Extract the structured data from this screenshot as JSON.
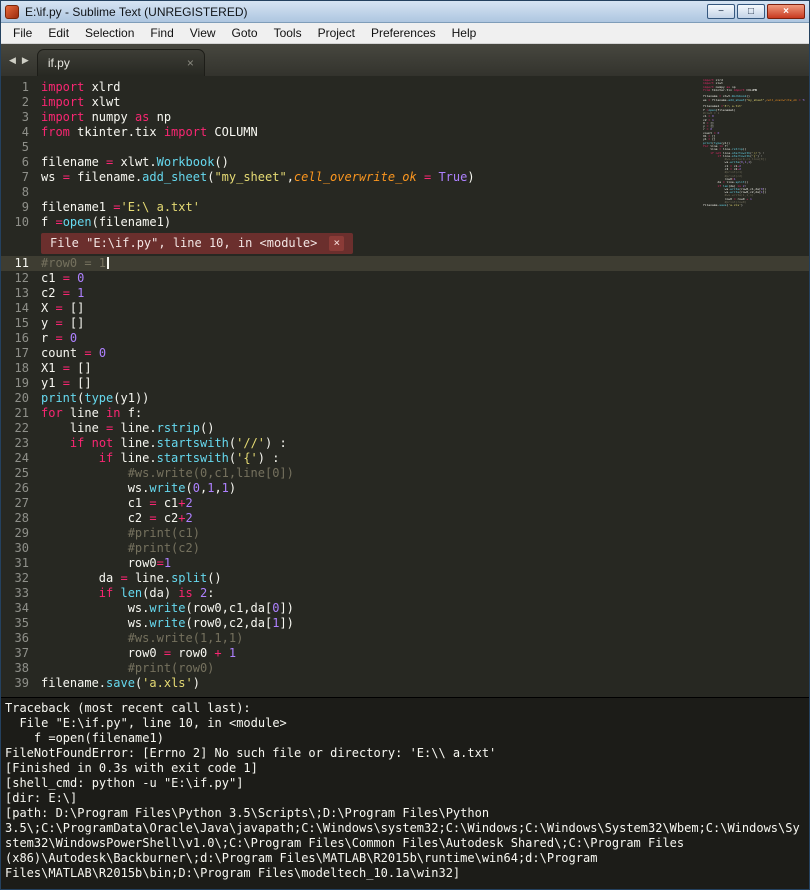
{
  "window": {
    "title": "E:\\if.py - Sublime Text (UNREGISTERED)",
    "controls": {
      "minimize": "−",
      "maximize": "□",
      "close": "×"
    }
  },
  "menu": {
    "items": [
      "File",
      "Edit",
      "Selection",
      "Find",
      "View",
      "Goto",
      "Tools",
      "Project",
      "Preferences",
      "Help"
    ]
  },
  "tabbar": {
    "nav_left": "◀",
    "nav_right": "▶"
  },
  "tabs": [
    {
      "label": "if.py",
      "close": "×"
    }
  ],
  "phantom": {
    "text": "File \"E:\\if.py\", line 10, in <module>",
    "close": "×"
  },
  "colors": {
    "editor_bg": "#272822",
    "keyword": "#f92672",
    "string": "#e6db74",
    "comment": "#75715e",
    "function": "#66d9ef",
    "constant": "#ae81ff",
    "parameter": "#fd971f",
    "plain": "#f8f8f2",
    "phantom_bg": "#6b2f2d",
    "active_line_bg": "#3e3d32"
  },
  "editor": {
    "active_line": 11,
    "phantom_after": 10,
    "lines": [
      {
        "n": 1,
        "t": [
          [
            "k",
            "import"
          ],
          [
            "p",
            " xlrd"
          ]
        ]
      },
      {
        "n": 2,
        "t": [
          [
            "k",
            "import"
          ],
          [
            "p",
            " xlwt"
          ]
        ]
      },
      {
        "n": 3,
        "t": [
          [
            "k",
            "import"
          ],
          [
            "p",
            " numpy "
          ],
          [
            "k",
            "as"
          ],
          [
            "p",
            " np"
          ]
        ]
      },
      {
        "n": 4,
        "t": [
          [
            "k",
            "from"
          ],
          [
            "p",
            " tkinter.tix "
          ],
          [
            "k",
            "import"
          ],
          [
            "p",
            " COLUMN"
          ]
        ]
      },
      {
        "n": 5,
        "t": []
      },
      {
        "n": 6,
        "t": [
          [
            "p",
            "filename "
          ],
          [
            "k",
            "="
          ],
          [
            "p",
            " xlwt."
          ],
          [
            "f",
            "Workbook"
          ],
          [
            "p",
            "()"
          ]
        ]
      },
      {
        "n": 7,
        "t": [
          [
            "p",
            "ws "
          ],
          [
            "k",
            "="
          ],
          [
            "p",
            " filename."
          ],
          [
            "f",
            "add_sheet"
          ],
          [
            "p",
            "("
          ],
          [
            "s",
            "\"my_sheet\""
          ],
          [
            "p",
            ","
          ],
          [
            "a",
            "cell_overwrite_ok"
          ],
          [
            "p",
            " "
          ],
          [
            "k",
            "="
          ],
          [
            "p",
            " "
          ],
          [
            "d",
            "True"
          ],
          [
            "p",
            ")"
          ]
        ]
      },
      {
        "n": 8,
        "t": []
      },
      {
        "n": 9,
        "t": [
          [
            "p",
            "filename1 "
          ],
          [
            "k",
            "="
          ],
          [
            "s",
            "'E:\\ a.txt'"
          ]
        ]
      },
      {
        "n": 10,
        "t": [
          [
            "p",
            "f "
          ],
          [
            "k",
            "="
          ],
          [
            "f",
            "open"
          ],
          [
            "p",
            "(filename1)"
          ]
        ]
      },
      {
        "n": 11,
        "t": [
          [
            "c",
            "#row0 = 1"
          ]
        ]
      },
      {
        "n": 12,
        "t": [
          [
            "p",
            "c1 "
          ],
          [
            "k",
            "="
          ],
          [
            "p",
            " "
          ],
          [
            "d",
            "0"
          ]
        ]
      },
      {
        "n": 13,
        "t": [
          [
            "p",
            "c2 "
          ],
          [
            "k",
            "="
          ],
          [
            "p",
            " "
          ],
          [
            "d",
            "1"
          ]
        ]
      },
      {
        "n": 14,
        "t": [
          [
            "p",
            "X "
          ],
          [
            "k",
            "="
          ],
          [
            "p",
            " []"
          ]
        ]
      },
      {
        "n": 15,
        "t": [
          [
            "p",
            "y "
          ],
          [
            "k",
            "="
          ],
          [
            "p",
            " []"
          ]
        ]
      },
      {
        "n": 16,
        "t": [
          [
            "p",
            "r "
          ],
          [
            "k",
            "="
          ],
          [
            "p",
            " "
          ],
          [
            "d",
            "0"
          ]
        ]
      },
      {
        "n": 17,
        "t": [
          [
            "p",
            "count "
          ],
          [
            "k",
            "="
          ],
          [
            "p",
            " "
          ],
          [
            "d",
            "0"
          ]
        ]
      },
      {
        "n": 18,
        "t": [
          [
            "p",
            "X1 "
          ],
          [
            "k",
            "="
          ],
          [
            "p",
            " []"
          ]
        ]
      },
      {
        "n": 19,
        "t": [
          [
            "p",
            "y1 "
          ],
          [
            "k",
            "="
          ],
          [
            "p",
            " []"
          ]
        ]
      },
      {
        "n": 20,
        "t": [
          [
            "f",
            "print"
          ],
          [
            "p",
            "("
          ],
          [
            "f",
            "type"
          ],
          [
            "p",
            "(y1))"
          ]
        ]
      },
      {
        "n": 21,
        "t": [
          [
            "k",
            "for"
          ],
          [
            "p",
            " line "
          ],
          [
            "k",
            "in"
          ],
          [
            "p",
            " f:"
          ]
        ]
      },
      {
        "n": 22,
        "t": [
          [
            "p",
            "    line "
          ],
          [
            "k",
            "="
          ],
          [
            "p",
            " line."
          ],
          [
            "f",
            "rstrip"
          ],
          [
            "p",
            "()"
          ]
        ]
      },
      {
        "n": 23,
        "t": [
          [
            "p",
            "    "
          ],
          [
            "k",
            "if"
          ],
          [
            "p",
            " "
          ],
          [
            "k",
            "not"
          ],
          [
            "p",
            " line."
          ],
          [
            "f",
            "startswith"
          ],
          [
            "p",
            "("
          ],
          [
            "s",
            "'//'"
          ],
          [
            "p",
            ") :"
          ]
        ]
      },
      {
        "n": 24,
        "t": [
          [
            "p",
            "        "
          ],
          [
            "k",
            "if"
          ],
          [
            "p",
            " line."
          ],
          [
            "f",
            "startswith"
          ],
          [
            "p",
            "("
          ],
          [
            "s",
            "'{'"
          ],
          [
            "p",
            ") :"
          ]
        ]
      },
      {
        "n": 25,
        "t": [
          [
            "c",
            "            #ws.write(0,c1,line[0])"
          ]
        ]
      },
      {
        "n": 26,
        "t": [
          [
            "p",
            "            ws."
          ],
          [
            "f",
            "write"
          ],
          [
            "p",
            "("
          ],
          [
            "d",
            "0"
          ],
          [
            "p",
            ","
          ],
          [
            "d",
            "1"
          ],
          [
            "p",
            ","
          ],
          [
            "d",
            "1"
          ],
          [
            "p",
            ")"
          ]
        ]
      },
      {
        "n": 27,
        "t": [
          [
            "p",
            "            c1 "
          ],
          [
            "k",
            "="
          ],
          [
            "p",
            " c1"
          ],
          [
            "k",
            "+"
          ],
          [
            "d",
            "2"
          ]
        ]
      },
      {
        "n": 28,
        "t": [
          [
            "p",
            "            c2 "
          ],
          [
            "k",
            "="
          ],
          [
            "p",
            " c2"
          ],
          [
            "k",
            "+"
          ],
          [
            "d",
            "2"
          ]
        ]
      },
      {
        "n": 29,
        "t": [
          [
            "c",
            "            #print(c1)"
          ]
        ]
      },
      {
        "n": 30,
        "t": [
          [
            "c",
            "            #print(c2)"
          ]
        ]
      },
      {
        "n": 31,
        "t": [
          [
            "p",
            "            row0"
          ],
          [
            "k",
            "="
          ],
          [
            "d",
            "1"
          ]
        ]
      },
      {
        "n": 32,
        "t": [
          [
            "p",
            "        da "
          ],
          [
            "k",
            "="
          ],
          [
            "p",
            " line."
          ],
          [
            "f",
            "split"
          ],
          [
            "p",
            "()"
          ]
        ]
      },
      {
        "n": 33,
        "t": [
          [
            "p",
            "        "
          ],
          [
            "k",
            "if"
          ],
          [
            "p",
            " "
          ],
          [
            "f",
            "len"
          ],
          [
            "p",
            "(da) "
          ],
          [
            "k",
            "is"
          ],
          [
            "p",
            " "
          ],
          [
            "d",
            "2"
          ],
          [
            "p",
            ":"
          ]
        ]
      },
      {
        "n": 34,
        "t": [
          [
            "p",
            "            ws."
          ],
          [
            "f",
            "write"
          ],
          [
            "p",
            "(row0,c1,da["
          ],
          [
            "d",
            "0"
          ],
          [
            "p",
            "])"
          ]
        ]
      },
      {
        "n": 35,
        "t": [
          [
            "p",
            "            ws."
          ],
          [
            "f",
            "write"
          ],
          [
            "p",
            "(row0,c2,da["
          ],
          [
            "d",
            "1"
          ],
          [
            "p",
            "])"
          ]
        ]
      },
      {
        "n": 36,
        "t": [
          [
            "c",
            "            #ws.write(1,1,1)"
          ]
        ]
      },
      {
        "n": 37,
        "t": [
          [
            "p",
            "            row0 "
          ],
          [
            "k",
            "="
          ],
          [
            "p",
            " row0 "
          ],
          [
            "k",
            "+"
          ],
          [
            "p",
            " "
          ],
          [
            "d",
            "1"
          ]
        ]
      },
      {
        "n": 38,
        "t": [
          [
            "c",
            "            #print(row0)"
          ]
        ]
      },
      {
        "n": 39,
        "t": [
          [
            "p",
            "filename."
          ],
          [
            "f",
            "save"
          ],
          [
            "p",
            "("
          ],
          [
            "s",
            "'a.xls'"
          ],
          [
            "p",
            ")"
          ]
        ]
      }
    ]
  },
  "console": {
    "lines": [
      "Traceback (most recent call last):",
      "  File \"E:\\if.py\", line 10, in <module>",
      "    f =open(filename1)",
      "FileNotFoundError: [Errno 2] No such file or directory: 'E:\\\\ a.txt'",
      "[Finished in 0.3s with exit code 1]",
      "[shell_cmd: python -u \"E:\\if.py\"]",
      "[dir: E:\\]",
      "[path: D:\\Program Files\\Python 3.5\\Scripts\\;D:\\Program Files\\Python 3.5\\;C:\\ProgramData\\Oracle\\Java\\javapath;C:\\Windows\\system32;C:\\Windows;C:\\Windows\\System32\\Wbem;C:\\Windows\\System32\\WindowsPowerShell\\v1.0\\;C:\\Program Files\\Common Files\\Autodesk Shared\\;C:\\Program Files (x86)\\Autodesk\\Backburner\\;d:\\Program Files\\MATLAB\\R2015b\\runtime\\win64;d:\\Program Files\\MATLAB\\R2015b\\bin;D:\\Program Files\\modeltech_10.1a\\win32]"
    ]
  }
}
